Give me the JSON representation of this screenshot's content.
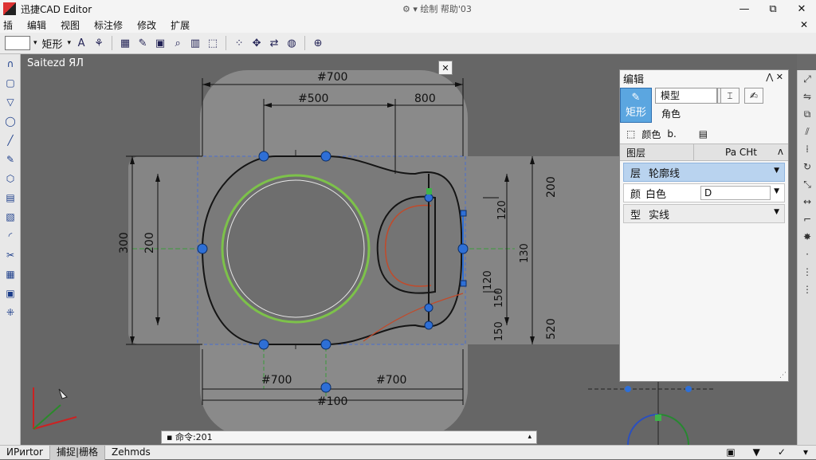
{
  "app": {
    "title": "迅捷CAD Editor",
    "title_mid": "⚙ ▾ 绘制  帮助'03"
  },
  "window": {
    "minimize": "—",
    "maximize": "⧉",
    "close": "✕"
  },
  "menu": {
    "items": [
      "插",
      "编辑",
      "视图",
      "标注修",
      "修改",
      "扩展"
    ],
    "right": "✕"
  },
  "toolbar": {
    "shape_label": "矩形",
    "dropdown": "▾"
  },
  "canvas": {
    "tab_label": "Saitezd ЯЛ",
    "close_label": "✕",
    "dimensions": {
      "top_overall": "#700",
      "top_inner": "#500",
      "top_right": "800",
      "bottom_left": "#700",
      "bottom_right": "#700",
      "bottom_overall": "#100",
      "left_outer": "300",
      "left_inner": "200",
      "right_a": "200",
      "right_b": "120",
      "right_c": "130",
      "right_d": "120",
      "right_e": "150",
      "right_f": "150",
      "right_g": "520"
    },
    "colors": {
      "outline": "#141414",
      "circle": "#7dc24a",
      "grip": "#2e6fd6",
      "center": "#3a9a3a",
      "arc": "#c24a2a",
      "dashed": "#4a6fd0"
    }
  },
  "panel": {
    "title": "编辑",
    "header_btns": "⋀ ✕",
    "pen_label": "矩形",
    "combo_value": "模型",
    "sub_label": "角色",
    "color_line": {
      "label": "颜色",
      "value": "b."
    },
    "section": {
      "label": "图层",
      "right": "Pa CHt",
      "caret": "ʌ"
    },
    "layer": {
      "label": "层",
      "value": "轮廓线"
    },
    "color": {
      "label": "颜",
      "value": "白色",
      "box": "D"
    },
    "linetype": {
      "label": "型",
      "value": "实线"
    }
  },
  "command": {
    "text": "▪ 命令:201",
    "caret": "▴"
  },
  "status": {
    "items": [
      "ИРиrtor",
      "捕捉|栅格",
      "Zehmds"
    ],
    "right": [
      "▣",
      "▼",
      "✓",
      "▾"
    ]
  }
}
